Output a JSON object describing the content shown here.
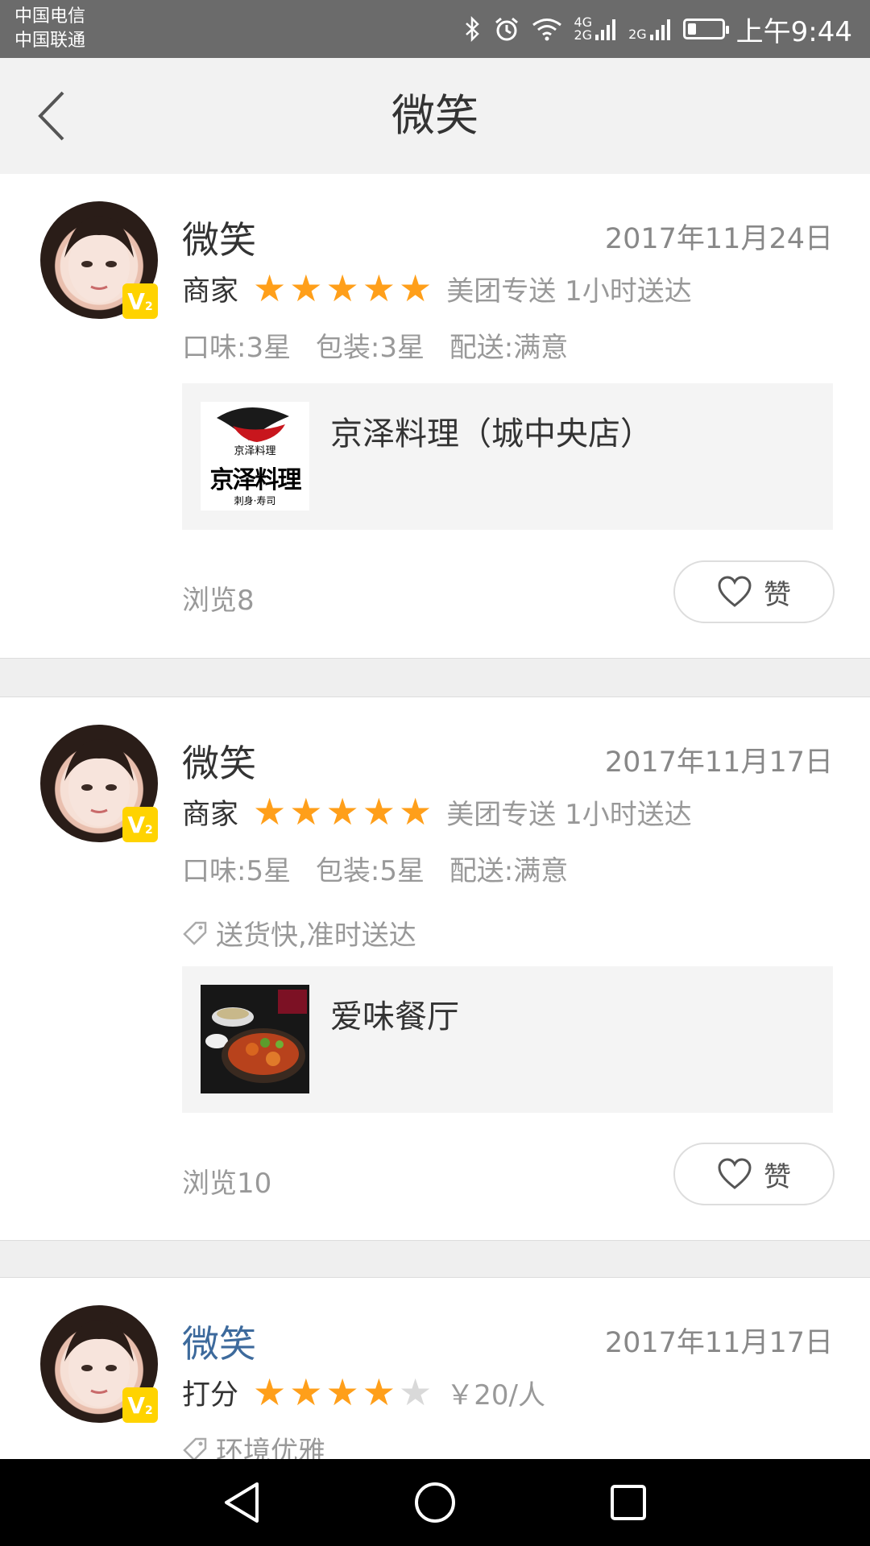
{
  "status_bar": {
    "carrier_1": "中国电信",
    "carrier_2": "中国联通",
    "net_4g": "4G",
    "net_2g": "2G",
    "net_2g_b": "2G",
    "battery_level": 0.25,
    "time": "上午9:44"
  },
  "nav": {
    "title": "微笑"
  },
  "reviews": [
    {
      "user": "微笑",
      "badge": "V",
      "badge_sub": "2",
      "date": "2017年11月24日",
      "rate_label": "商家",
      "stars": 5,
      "delivery": "美团专送 1小时送达",
      "score_taste": "口味:3星",
      "score_pack": "包装:3星",
      "score_delivery": "配送:满意",
      "shop_name": "京泽料理（城中央店）",
      "shop_logo_text_1": "京泽料理",
      "shop_logo_text_2": "京泽料理",
      "shop_logo_text_3": "刺身·寿司",
      "views": "浏览8",
      "like_label": "赞"
    },
    {
      "user": "微笑",
      "badge": "V",
      "badge_sub": "2",
      "date": "2017年11月17日",
      "rate_label": "商家",
      "stars": 5,
      "delivery": "美团专送 1小时送达",
      "score_taste": "口味:5星",
      "score_pack": "包装:5星",
      "score_delivery": "配送:满意",
      "tag": "送货快,准时送达",
      "shop_name": "爱味餐厅",
      "views": "浏览10",
      "like_label": "赞"
    },
    {
      "user": "微笑",
      "badge": "V",
      "badge_sub": "2",
      "date": "2017年11月17日",
      "rate_label": "打分",
      "stars": 4,
      "price": "￥20/人",
      "tag": "环境优雅"
    }
  ],
  "colors": {
    "star_on": "#ff9f1a",
    "star_off": "#d9d9d9",
    "user_link": "#3d6a9c",
    "badge": "#ffd300"
  }
}
